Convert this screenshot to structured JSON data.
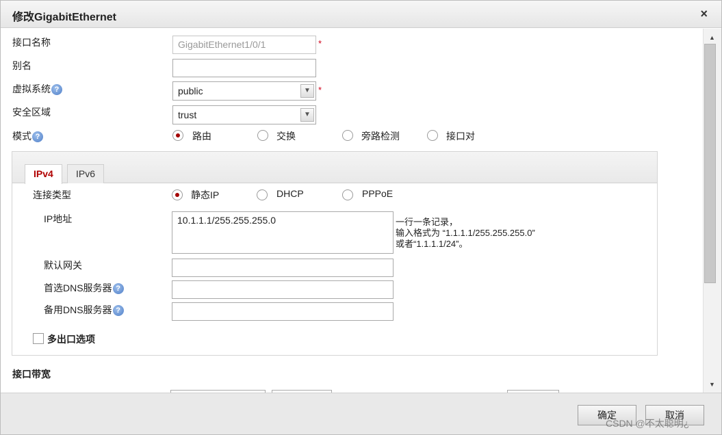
{
  "dialog": {
    "title": "修改GigabitEthernet",
    "close_glyph": "×"
  },
  "form": {
    "interface_name_label": "接口名称",
    "interface_name_value": "GigabitEthernet1/0/1",
    "alias_label": "别名",
    "alias_value": "",
    "vsys_label": "虚拟系统",
    "vsys_value": "public",
    "zone_label": "安全区域",
    "zone_value": "trust",
    "mode_label": "模式",
    "mode_options": [
      "路由",
      "交换",
      "旁路检测",
      "接口对"
    ],
    "mode_selected": "路由",
    "required_mark": "*",
    "help_glyph": "?"
  },
  "ip_panel": {
    "tabs": [
      "IPv4",
      "IPv6"
    ],
    "active_tab": "IPv4",
    "conn_type_label": "连接类型",
    "conn_options": [
      "静态IP",
      "DHCP",
      "PPPoE"
    ],
    "conn_selected": "静态IP",
    "ip_label": "IP地址",
    "ip_value": "10.1.1.1/255.255.255.0",
    "hint_lines": [
      "一行一条记录，",
      "输入格式为 “1.1.1.1/255.255.255.0”",
      "或者“1.1.1.1/24”。"
    ],
    "gateway_label": "默认网关",
    "gateway_value": "",
    "dns1_label": "首选DNS服务器",
    "dns1_value": "",
    "dns2_label": "备用DNS服务器",
    "dns2_value": "",
    "multi_exit_label": "多出口选项",
    "multi_exit_checked": false
  },
  "bandwidth": {
    "section_label": "接口带宽"
  },
  "footer": {
    "ok_label": "确定",
    "cancel_label": "取消",
    "watermark": "CSDN @不太聪明¿"
  },
  "scrollbar": {
    "up_glyph": "▲",
    "down_glyph": "▼"
  },
  "colors": {
    "accent_red": "#b00000",
    "required_red": "#d0021b"
  }
}
